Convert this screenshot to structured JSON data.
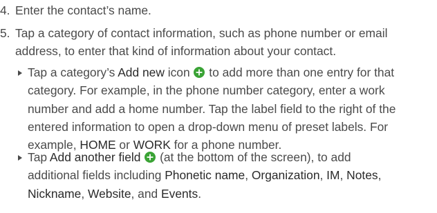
{
  "steps": [
    {
      "number": "4.",
      "text": "Enter the contact’s name."
    },
    {
      "number": "5.",
      "line1": "Tap a category of contact information, such as phone number or email",
      "line2": "address, to enter that kind of information about your contact."
    }
  ],
  "bullets": [
    {
      "icon": "add-circle-icon",
      "segments": {
        "a": "Tap a category’s ",
        "b": "Add new",
        "c": " icon ",
        "d": " to add more than one entry for that",
        "e": "category. For example, in the phone number category, enter a work",
        "f": "number and add a home number. Tap the label field to the right of the",
        "g": "entered information to open a drop-down menu of preset labels. For",
        "h": "example, ",
        "i": "HOME",
        "j": " or ",
        "k": "WORK",
        "l": " for a phone number."
      }
    },
    {
      "icon": "add-circle-icon",
      "segments": {
        "a": "Tap ",
        "b": "Add another field",
        "c": " (at the bottom of the screen), to add",
        "d": "additional fields including ",
        "e": "Phonetic name",
        "f": ", ",
        "g": "Organization",
        "h": ", ",
        "i": "IM",
        "j": ", ",
        "k": "Notes",
        "l": ",",
        "m": "Nickname",
        "n": ", ",
        "o": "Website",
        "p": ", and ",
        "q": "Events",
        "r": "."
      }
    }
  ],
  "colors": {
    "text": "#4a4a4a",
    "keyword": "#2a2a2a",
    "icon_green": "#3aa335"
  }
}
